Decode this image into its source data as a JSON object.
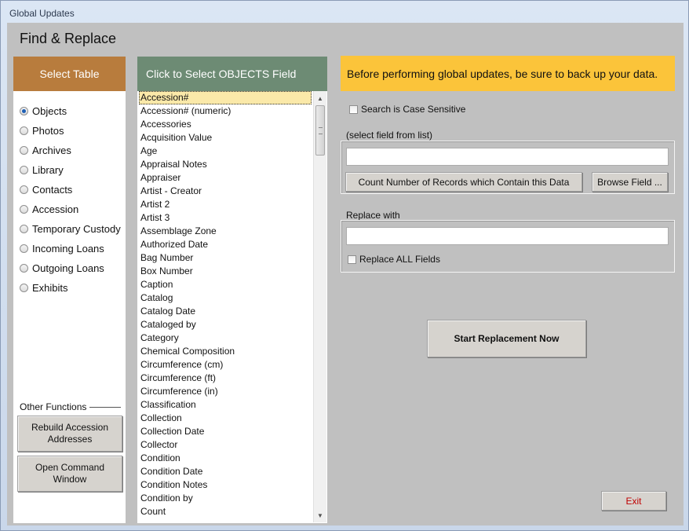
{
  "window": {
    "title": "Global Updates"
  },
  "page": {
    "heading": "Find & Replace"
  },
  "select_table": {
    "header": "Select Table",
    "options": [
      "Objects",
      "Photos",
      "Archives",
      "Library",
      "Contacts",
      "Accession",
      "Temporary Custody",
      "Incoming Loans",
      "Outgoing Loans",
      "Exhibits"
    ],
    "selected": "Objects"
  },
  "other_functions": {
    "label": "Other Functions",
    "rebuild_line1": "Rebuild Accession",
    "rebuild_line2": "Addresses",
    "command_line1": "Open Command",
    "command_line2": "Window"
  },
  "field_list": {
    "header": "Click to Select OBJECTS Field",
    "selected": "Accession#",
    "items": [
      "Accession#",
      "Accession# (numeric)",
      "Accessories",
      "Acquisition Value",
      "Age",
      "Appraisal Notes",
      "Appraiser",
      "Artist - Creator",
      "Artist 2",
      "Artist 3",
      "Assemblage Zone",
      "Authorized Date",
      "Bag Number",
      "Box Number",
      "Caption",
      "Catalog",
      "Catalog Date",
      "Cataloged by",
      "Category",
      "Chemical Composition",
      "Circumference (cm)",
      "Circumference (ft)",
      "Circumference (in)",
      "Classification",
      "Collection",
      "Collection Date",
      "Collector",
      "Condition",
      "Condition Date",
      "Condition Notes",
      "Condition by",
      "Count"
    ]
  },
  "warning": "Before performing global updates, be sure to back up your data.",
  "search": {
    "case_sensitive_label": "Search is Case Sensitive",
    "case_sensitive": false,
    "select_field_label": "(select field from list)",
    "find_value": "",
    "count_button": "Count Number of Records which Contain this Data",
    "browse_button": "Browse Field ..."
  },
  "replace": {
    "label": "Replace with",
    "value": "",
    "replace_all_label": "Replace ALL Fields",
    "replace_all": false
  },
  "actions": {
    "start_button": "Start Replacement Now",
    "exit_button": "Exit"
  }
}
